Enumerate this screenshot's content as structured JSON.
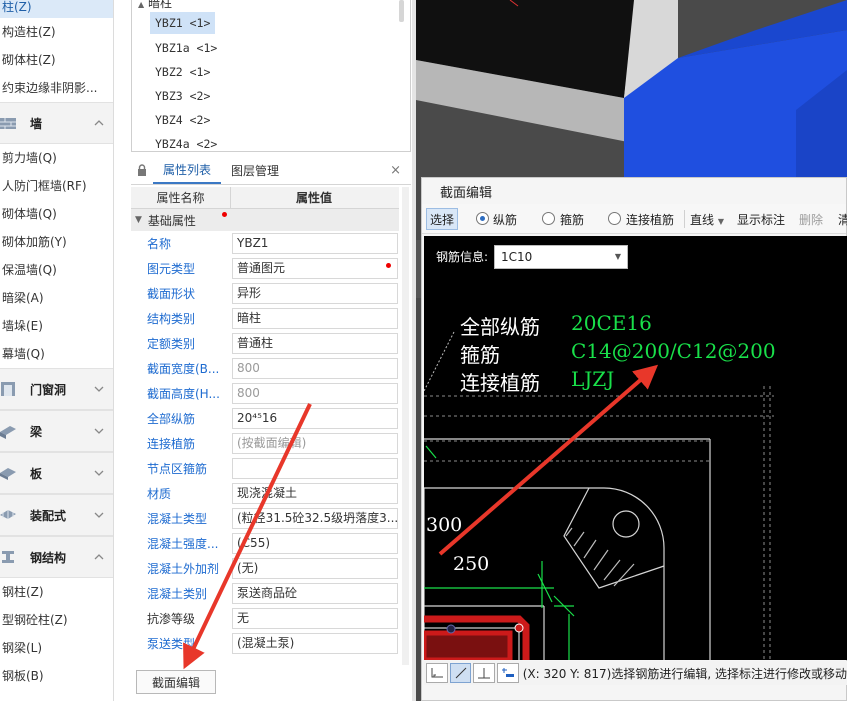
{
  "nav": {
    "items_top": [
      "柱(Z)",
      "构造柱(Z)",
      "砌体柱(Z)",
      "约束边缘非阴影..."
    ],
    "cat_wall": "墙",
    "items_wall": [
      "剪力墙(Q)",
      "人防门框墙(RF)",
      "砌体墙(Q)",
      "砌体加筋(Y)",
      "保温墙(Q)",
      "暗梁(A)",
      "墙垛(E)",
      "幕墙(Q)"
    ],
    "cat_door": "门窗洞",
    "cat_beam": "梁",
    "cat_slab": "板",
    "cat_prefab": "装配式",
    "cat_steel": "钢结构",
    "items_steel": [
      "钢柱(Z)",
      "型钢砼柱(Z)",
      "钢梁(L)",
      "钢板(B)"
    ]
  },
  "tree": {
    "group": "暗柱",
    "items": [
      "YBZ1 <1>",
      "YBZ1a <1>",
      "YBZ2 <1>",
      "YBZ3 <2>",
      "YBZ4 <2>",
      "YBZ4a <2>"
    ]
  },
  "props": {
    "tab_props": "属性列表",
    "tab_layers": "图层管理",
    "close": "×",
    "col_name": "属性名称",
    "col_value": "属性值",
    "section": "基础属性",
    "rows": [
      {
        "k": "名称",
        "v": "YBZ1"
      },
      {
        "k": "图元类型",
        "v": "普通图元"
      },
      {
        "k": "截面形状",
        "v": "异形"
      },
      {
        "k": "结构类别",
        "v": "暗柱"
      },
      {
        "k": "定额类别",
        "v": "普通柱"
      },
      {
        "k": "截面宽度(B...",
        "v": "800"
      },
      {
        "k": "截面高度(H...",
        "v": "800"
      },
      {
        "k": "全部纵筋",
        "v": "20⁴⁵16"
      },
      {
        "k": "连接植筋",
        "v": "(按截面编辑)"
      },
      {
        "k": "节点区箍筋",
        "v": ""
      },
      {
        "k": "材质",
        "v": "现浇混凝土"
      },
      {
        "k": "混凝土类型",
        "v": "(粒径31.5砼32.5级坍落度3..."
      },
      {
        "k": "混凝土强度...",
        "v": "(C55)"
      },
      {
        "k": "混凝土外加剂",
        "v": "(无)"
      },
      {
        "k": "混凝土类别",
        "v": "泵送商品砼"
      },
      {
        "k": "抗渗等级",
        "v": "无"
      },
      {
        "k": "泵送类型",
        "v": "(混凝土泵)"
      }
    ],
    "edit_button": "截面编辑"
  },
  "dialog": {
    "title": "截面编辑",
    "toolbar": {
      "select": "选择",
      "longitudinal": "纵筋",
      "stirrup": "箍筋",
      "connect": "连接植筋",
      "line": "直线",
      "show_dim": "显示标注",
      "delete": "删除",
      "clear": "清"
    },
    "rebar_info_label": "钢筋信息:",
    "rebar_info_value": "1C10",
    "cad": {
      "label_all": "全部纵筋",
      "label_stirrup": "箍筋",
      "label_connect": "连接植筋",
      "val_all": "20CE16",
      "val_stirrup": "C14@200/C12@200",
      "val_connect": "LJZJ",
      "dim1": "300",
      "dim2": "250"
    },
    "status": "(X: 320 Y: 817)选择钢筋进行编辑, 选择标注进行修改或移动"
  },
  "colors": {
    "accent": "#3b78c4",
    "cad_green": "#19e04a",
    "arrow_red": "#e8372a",
    "view_blue": "#1f4fe0"
  }
}
